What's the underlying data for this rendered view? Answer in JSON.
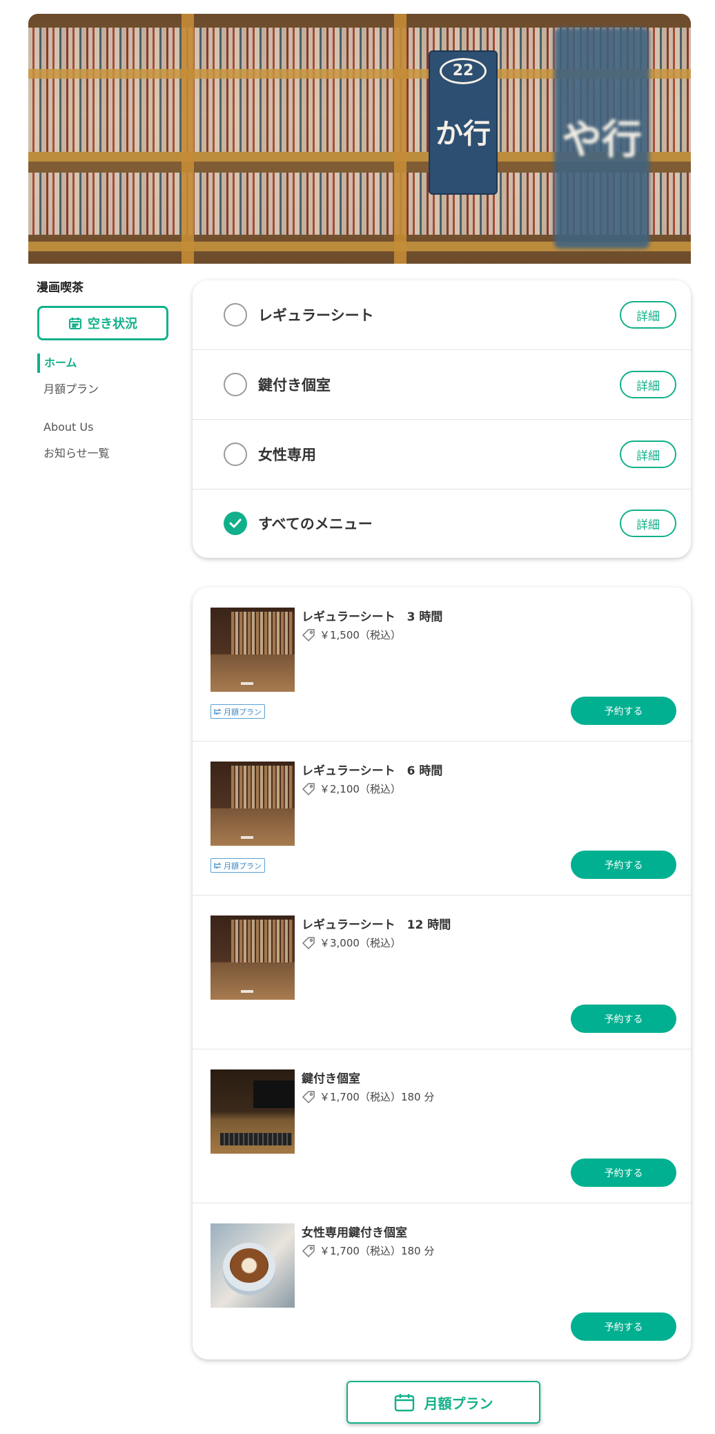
{
  "hero": {
    "sign_small": "22",
    "sign_text_a": "か行",
    "sign_text_b": "や行"
  },
  "brand": {
    "name": "漫画喫茶"
  },
  "availability_button": {
    "label": "空き状況",
    "icon": "calendar-icon"
  },
  "sidebar": {
    "items": [
      {
        "label": "ホーム",
        "active": true
      },
      {
        "label": "月額プラン",
        "active": false
      },
      {
        "label": "About Us",
        "active": false
      },
      {
        "label": "お知らせ一覧",
        "active": false
      }
    ]
  },
  "filters": {
    "detail_label": "詳細",
    "options": [
      {
        "label": "レギュラーシート",
        "checked": false
      },
      {
        "label": "鍵付き個室",
        "checked": false
      },
      {
        "label": "女性専用",
        "checked": false
      },
      {
        "label": "すべてのメニュー",
        "checked": true
      }
    ]
  },
  "plans": {
    "reserve_label": "予約する",
    "monthly_badge_label": "月額プラン",
    "items": [
      {
        "title": "レギュラーシート　3 時間",
        "price": "￥1,500（税込）",
        "image": "bookshelf",
        "monthly": true
      },
      {
        "title": "レギュラーシート　6 時間",
        "price": "￥2,100（税込）",
        "image": "bookshelf",
        "monthly": true
      },
      {
        "title": "レギュラーシート　12 時間",
        "price": "￥3,000（税込）",
        "image": "bookshelf",
        "monthly": false
      },
      {
        "title": "鍵付き個室",
        "price": "￥1,700（税込）180 分",
        "image": "desk",
        "monthly": false
      },
      {
        "title": "女性専用鍵付き個室",
        "price": "￥1,700（税込）180 分",
        "image": "coffee",
        "monthly": false
      }
    ]
  },
  "monthly_plan_button": {
    "label": "月額プラン",
    "icon": "calendar-icon"
  },
  "colors": {
    "accent": "#12b08a",
    "reserve": "#00b090",
    "badge": "#3a88c6"
  }
}
